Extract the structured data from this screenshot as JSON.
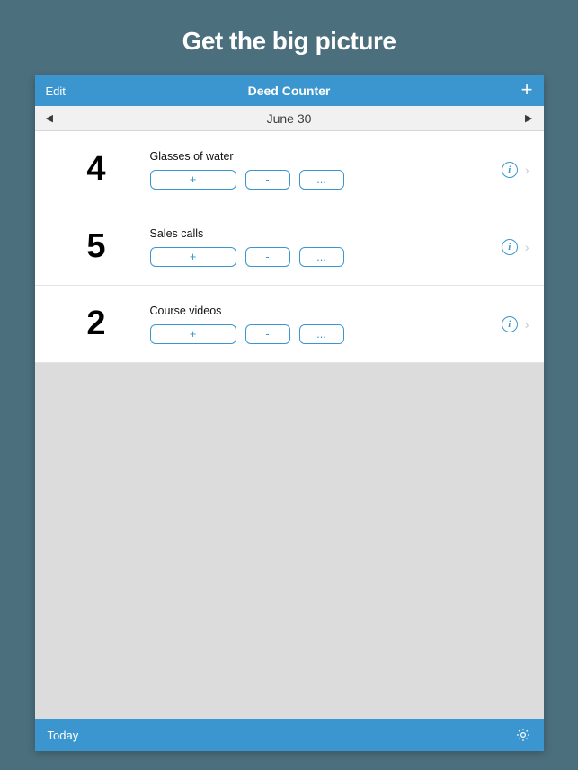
{
  "promo": {
    "title": "Get the big picture"
  },
  "nav": {
    "edit": "Edit",
    "title": "Deed Counter",
    "add_icon": "plus-icon"
  },
  "date_bar": {
    "prev_icon": "triangle-left",
    "label": "June 30",
    "next_icon": "triangle-right"
  },
  "items": [
    {
      "count": "4",
      "title": "Glasses of water",
      "buttons": {
        "plus": "+",
        "minus": "-",
        "more": "..."
      }
    },
    {
      "count": "5",
      "title": "Sales calls",
      "buttons": {
        "plus": "+",
        "minus": "-",
        "more": "..."
      }
    },
    {
      "count": "2",
      "title": "Course videos",
      "buttons": {
        "plus": "+",
        "minus": "-",
        "more": "..."
      }
    }
  ],
  "toolbar": {
    "today": "Today",
    "settings_icon": "gear-icon"
  },
  "colors": {
    "background": "#4c6f7d",
    "accent": "#3b96cf",
    "list_bg": "#ffffff",
    "empty_bg": "#dcdcdc"
  }
}
